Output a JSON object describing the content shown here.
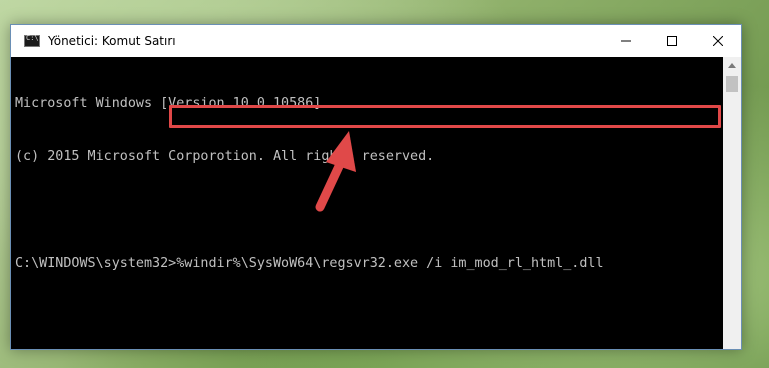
{
  "window": {
    "title": "Yönetici: Komut Satırı",
    "icon": "console-icon",
    "controls": [
      "minimize-icon",
      "maximize-icon",
      "close-icon"
    ]
  },
  "console": {
    "lines": [
      "Microsoft Windows [Version 10.0.10586]",
      "(c) 2015 Microsoft Corporotion. All rights reserved.",
      ""
    ],
    "prompt": "C:\\WINDOWS\\system32>",
    "command": "%windir%\\SysWoW64\\regsvr32.exe /i im_mod_rl_html_.dll"
  },
  "annotation": {
    "highlight_color": "#e04848",
    "arrow_color": "#e04848"
  }
}
